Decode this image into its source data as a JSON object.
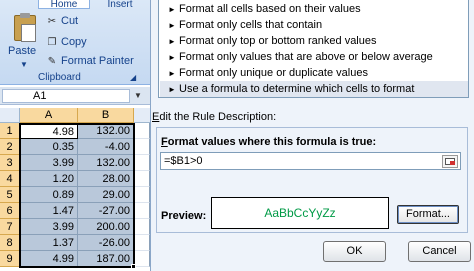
{
  "ribbon": {
    "tabs": [
      {
        "label": "Home"
      },
      {
        "label": "Insert"
      }
    ],
    "paste_label": "Paste",
    "cut_label": "Cut",
    "copy_label": "Copy",
    "format_painter_label": "Format Painter",
    "group_label": "Clipboard"
  },
  "namebox": {
    "value": "A1"
  },
  "grid": {
    "columns": [
      "A",
      "B"
    ],
    "rows": [
      {
        "num": "1",
        "a": "4.98",
        "b": "132.00"
      },
      {
        "num": "2",
        "a": "0.35",
        "b": "-4.00"
      },
      {
        "num": "3",
        "a": "3.99",
        "b": "132.00"
      },
      {
        "num": "4",
        "a": "1.20",
        "b": "28.00"
      },
      {
        "num": "5",
        "a": "0.89",
        "b": "29.00"
      },
      {
        "num": "6",
        "a": "1.47",
        "b": "-27.00"
      },
      {
        "num": "7",
        "a": "3.99",
        "b": "200.00"
      },
      {
        "num": "8",
        "a": "1.37",
        "b": "-26.00"
      },
      {
        "num": "9",
        "a": "4.99",
        "b": "187.00"
      }
    ]
  },
  "dialog": {
    "rule_types": [
      "Format all cells based on their values",
      "Format only cells that contain",
      "Format only top or bottom ranked values",
      "Format only values that are above or below average",
      "Format only unique or duplicate values",
      "Use a formula to determine which cells to format"
    ],
    "selected_rule_index": 5,
    "description_label_prefix": "E",
    "description_label_rest": "dit the Rule Description:",
    "formula_label_prefix": "F",
    "formula_label_rest": "ormat values where this formula is true:",
    "formula_value": "=$B1>0",
    "preview_label": "Preview:",
    "preview_text": "AaBbCcYyZz",
    "preview_color": "#009a46",
    "format_button_label": "Format...",
    "ok_label": "OK",
    "cancel_label": "Cancel"
  }
}
